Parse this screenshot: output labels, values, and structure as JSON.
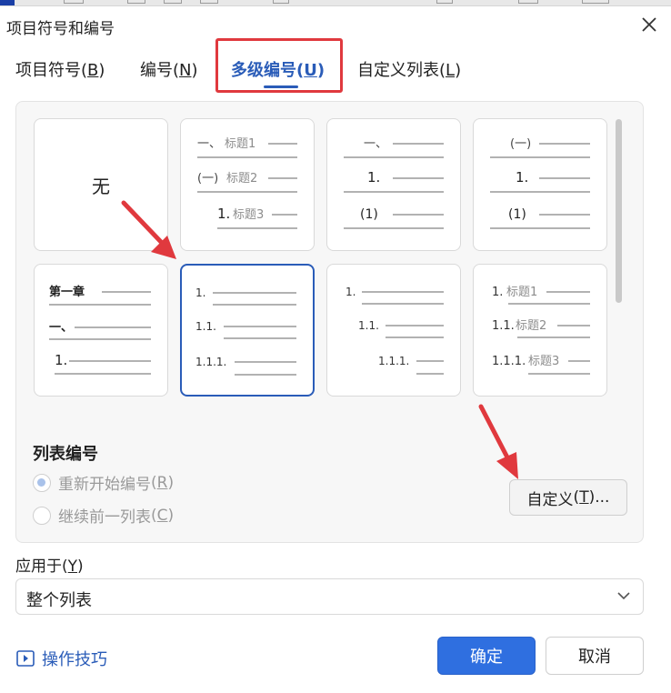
{
  "dialog": {
    "title": "项目符号和编号",
    "close_icon": "close-icon"
  },
  "tabs": [
    {
      "label": "项目符号",
      "key": "B",
      "active": false
    },
    {
      "label": "编号",
      "key": "N",
      "active": false
    },
    {
      "label": "多级编号",
      "key": "U",
      "active": true
    },
    {
      "label": "自定义列表",
      "key": "L",
      "active": false
    }
  ],
  "presets": [
    {
      "id": "none",
      "label": "无",
      "lines": []
    },
    {
      "id": "chinese-headings",
      "lines": [
        {
          "prefix": "一、",
          "text": "标题1"
        },
        {
          "prefix": "(一)",
          "text": "标题2"
        },
        {
          "prefix": "1.",
          "text": "标题3"
        }
      ]
    },
    {
      "id": "chinese-plain",
      "lines": [
        {
          "prefix": "一、",
          "text": ""
        },
        {
          "prefix": "1.",
          "text": ""
        },
        {
          "prefix": "(1)",
          "text": ""
        }
      ]
    },
    {
      "id": "paren-chinese",
      "lines": [
        {
          "prefix": "(一)",
          "text": ""
        },
        {
          "prefix": "1.",
          "text": ""
        },
        {
          "prefix": "(1)",
          "text": ""
        }
      ]
    },
    {
      "id": "chapter",
      "lines": [
        {
          "prefix": "第一章",
          "text": ""
        },
        {
          "prefix": "一、",
          "text": ""
        },
        {
          "prefix": "1.",
          "text": ""
        }
      ]
    },
    {
      "id": "decimal-multilevel",
      "selected": true,
      "lines": [
        {
          "prefix": "1.",
          "text": ""
        },
        {
          "prefix": "1.1.",
          "text": ""
        },
        {
          "prefix": "1.1.1.",
          "text": ""
        }
      ]
    },
    {
      "id": "decimal-indented",
      "lines": [
        {
          "prefix": "1.",
          "text": ""
        },
        {
          "prefix": "1.1.",
          "text": ""
        },
        {
          "prefix": "1.1.1.",
          "text": ""
        }
      ]
    },
    {
      "id": "decimal-headings",
      "lines": [
        {
          "prefix": "1.",
          "text": "标题1"
        },
        {
          "prefix": "1.1.",
          "text": "标题2"
        },
        {
          "prefix": "1.1.1.",
          "text": "标题3"
        }
      ]
    }
  ],
  "list_numbering": {
    "title": "列表编号",
    "restart": {
      "label": "重新开始编号",
      "key": "R",
      "checked": true,
      "disabled": true
    },
    "continue": {
      "label": "继续前一列表",
      "key": "C",
      "checked": false,
      "disabled": true
    }
  },
  "customize_button": {
    "label": "自定义",
    "key": "T",
    "suffix": "..."
  },
  "apply_to": {
    "label": "应用于",
    "key": "Y",
    "selected": "整个列表"
  },
  "footer": {
    "tips_label": "操作技巧",
    "ok_label": "确定",
    "cancel_label": "取消"
  },
  "colors": {
    "accent": "#2a5cb8",
    "primary_button": "#2f6fe0",
    "annotation": "#e0393e"
  }
}
